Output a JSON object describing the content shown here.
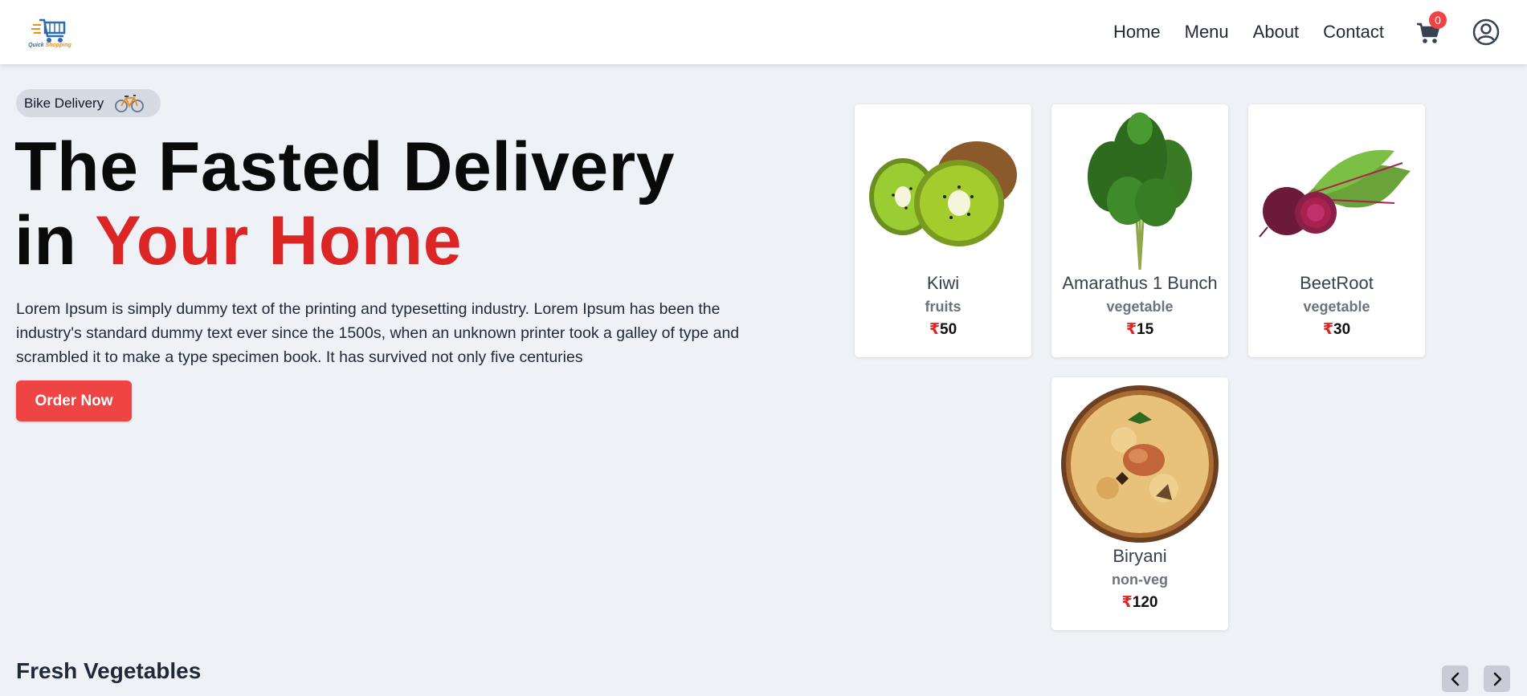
{
  "header": {
    "logo_text_1": "Quick",
    "logo_text_2": " Shopping",
    "nav": [
      "Home",
      "Menu",
      "About",
      "Contact"
    ],
    "cart_count": "0"
  },
  "hero": {
    "badge_label": "Bike Delivery",
    "headline_line1": "The Fasted Delivery",
    "headline_in": "in ",
    "headline_accent": "Your Home",
    "description": "Lorem Ipsum is simply dummy text of the printing and typesetting industry. Lorem Ipsum has been the industry's standard dummy text ever since the 1500s, when an unknown printer took a galley of type and scrambled it to make a type specimen book. It has survived not only five centuries",
    "order_button": "Order Now"
  },
  "products": [
    {
      "name": "Kiwi",
      "category": "fruits",
      "currency": "₹",
      "price": "50"
    },
    {
      "name": "Amarathus 1 Bunch",
      "category": "vegetable",
      "currency": "₹",
      "price": "15"
    },
    {
      "name": "BeetRoot",
      "category": "vegetable",
      "currency": "₹",
      "price": "30"
    },
    {
      "name": "Biryani",
      "category": "non-veg",
      "currency": "₹",
      "price": "120"
    }
  ],
  "section": {
    "title": "Fresh Vegetables"
  },
  "colors": {
    "accent": "#dc2626",
    "button": "#ef4444",
    "background": "#eef1f6"
  }
}
